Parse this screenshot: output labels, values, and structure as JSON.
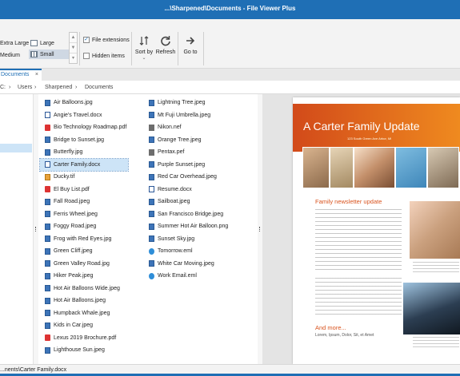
{
  "window": {
    "title": "...\\Sharpened\\Documents - File Viewer Plus"
  },
  "ribbon": {
    "sizes": {
      "extra_large": "Extra Large",
      "large": "Large",
      "medium": "Medium",
      "small": "Small"
    },
    "file_extensions": {
      "label": "File extensions",
      "checked": true
    },
    "hidden_items": {
      "label": "Hidden items",
      "checked": false
    },
    "sort_by": "Sort by",
    "refresh": "Refresh",
    "go_to": "Go to"
  },
  "tabs": [
    {
      "label": "Documents",
      "close": "×"
    }
  ],
  "path": {
    "root": "C:",
    "sep": "›",
    "parts": [
      "Users",
      "Sharpened",
      "Documents"
    ]
  },
  "files": {
    "col1": [
      {
        "name": "Air Balloons.jpg",
        "icon": "image-icon"
      },
      {
        "name": "Angie's Travel.docx",
        "icon": "doc-icon"
      },
      {
        "name": "Bio Technology Roadmap.pdf",
        "icon": "pdf-icon"
      },
      {
        "name": "Bridge to Sunset.jpg",
        "icon": "image-icon"
      },
      {
        "name": "Butterfly.jpg",
        "icon": "image-icon"
      },
      {
        "name": "Carter Family.docx",
        "icon": "doc-icon"
      },
      {
        "name": "Ducky.tif",
        "icon": "gif-icon"
      },
      {
        "name": "El Buy List.pdf",
        "icon": "pdf-icon"
      },
      {
        "name": "Fall Road.jpeg",
        "icon": "image-icon"
      },
      {
        "name": "Ferris Wheel.jpeg",
        "icon": "image-icon"
      },
      {
        "name": "Foggy Road.jpeg",
        "icon": "image-icon"
      },
      {
        "name": "Frog with Red Eyes.jpg",
        "icon": "image-icon"
      },
      {
        "name": "Green Cliff.jpeg",
        "icon": "image-icon"
      },
      {
        "name": "Green Valley Road.jpg",
        "icon": "image-icon"
      },
      {
        "name": "Hiker Peak.jpeg",
        "icon": "image-icon"
      },
      {
        "name": "Hot Air Balloons Wide.jpeg",
        "icon": "image-icon"
      },
      {
        "name": "Hot Air Balloons.jpeg",
        "icon": "image-icon"
      },
      {
        "name": "Humpback Whale.jpeg",
        "icon": "image-icon"
      },
      {
        "name": "Kids in Car.jpeg",
        "icon": "image-icon"
      },
      {
        "name": "Lexus 2019 Brochure.pdf",
        "icon": "pdf-icon"
      },
      {
        "name": "Lighthouse Sun.jpeg",
        "icon": "image-icon"
      }
    ],
    "col2": [
      {
        "name": "Lightning Tree.jpeg",
        "icon": "image-icon"
      },
      {
        "name": "Mt Fuji Umbrella.jpeg",
        "icon": "image-icon"
      },
      {
        "name": "Nikon.nef",
        "icon": "raw-icon"
      },
      {
        "name": "Orange Tree.jpeg",
        "icon": "image-icon"
      },
      {
        "name": "Pentax.pef",
        "icon": "raw-icon"
      },
      {
        "name": "Purple Sunset.jpeg",
        "icon": "image-icon"
      },
      {
        "name": "Red Car Overhead.jpeg",
        "icon": "image-icon"
      },
      {
        "name": "Resume.docx",
        "icon": "doc-icon"
      },
      {
        "name": "Sailboat.jpeg",
        "icon": "image-icon"
      },
      {
        "name": "San Francisco Bridge.jpeg",
        "icon": "image-icon"
      },
      {
        "name": "Summer Hot Air Balloon.png",
        "icon": "image-icon"
      },
      {
        "name": "Sunset Sky.jpg",
        "icon": "image-icon"
      },
      {
        "name": "Tomorrow.eml",
        "icon": "email-icon"
      },
      {
        "name": "White Car Moving.jpeg",
        "icon": "image-icon"
      },
      {
        "name": "Work Email.eml",
        "icon": "email-icon"
      }
    ],
    "selected": "Carter Family.docx"
  },
  "preview": {
    "title": "A Carter Family Update",
    "subtitle": "123 South Green Ave Arbor, MI",
    "section1": "Family newsletter update",
    "section2": "And more...",
    "footer_text": "Lorem, Ipsum, Dolor, Sit, et Amet"
  },
  "status": {
    "path": "...nents\\Carter Family.docx"
  },
  "colors": {
    "accent": "#1f6fb5",
    "selection": "#cde4f7",
    "newsletter_orange": "#d9531e"
  }
}
